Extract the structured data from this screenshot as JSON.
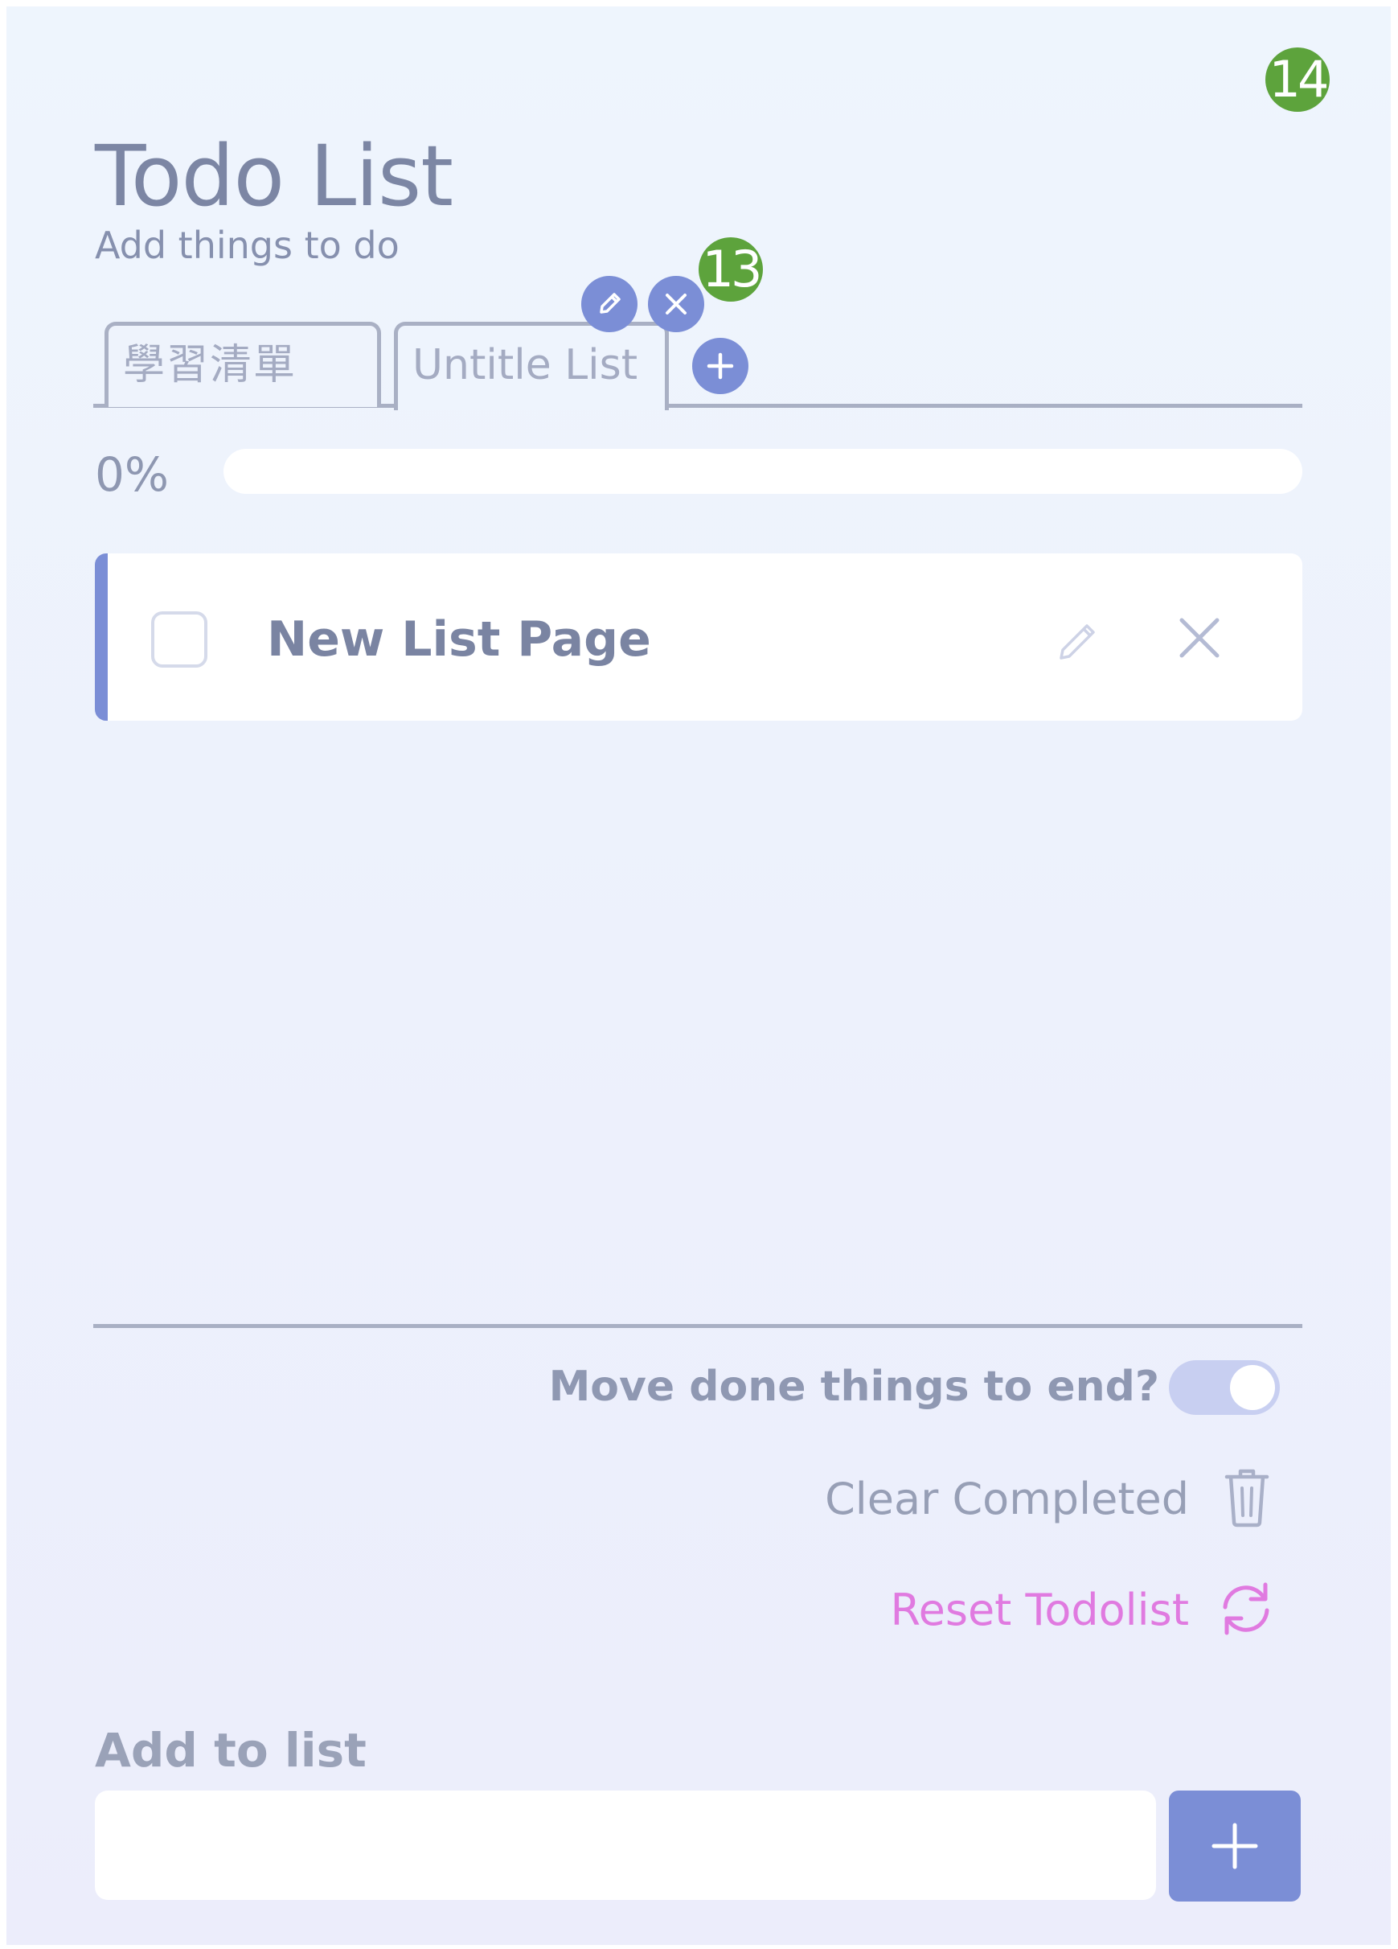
{
  "badges": {
    "top_right": "14",
    "tab_controls": "13"
  },
  "header": {
    "title": "Todo List",
    "subtitle": "Add things to do"
  },
  "tabs": [
    {
      "label": "學習清單",
      "active": false
    },
    {
      "label": "Untitle List",
      "active": true
    }
  ],
  "tab_controls": {
    "icons": [
      "pencil-icon",
      "close-icon",
      "plus-icon"
    ]
  },
  "progress": {
    "label": "0%",
    "value": 0
  },
  "todos": [
    {
      "text": "New List Page",
      "done": false
    }
  ],
  "options": {
    "move_done_label": "Move done things to end?",
    "move_done_enabled": true,
    "clear_label": "Clear Completed",
    "reset_label": "Reset Todolist"
  },
  "add": {
    "label": "Add to list",
    "input_value": "",
    "placeholder": ""
  },
  "colors": {
    "accent": "#7b8ed6",
    "reset": "#e07ae0",
    "badge": "#5da33c",
    "toggle_track": "#c8cff1"
  }
}
